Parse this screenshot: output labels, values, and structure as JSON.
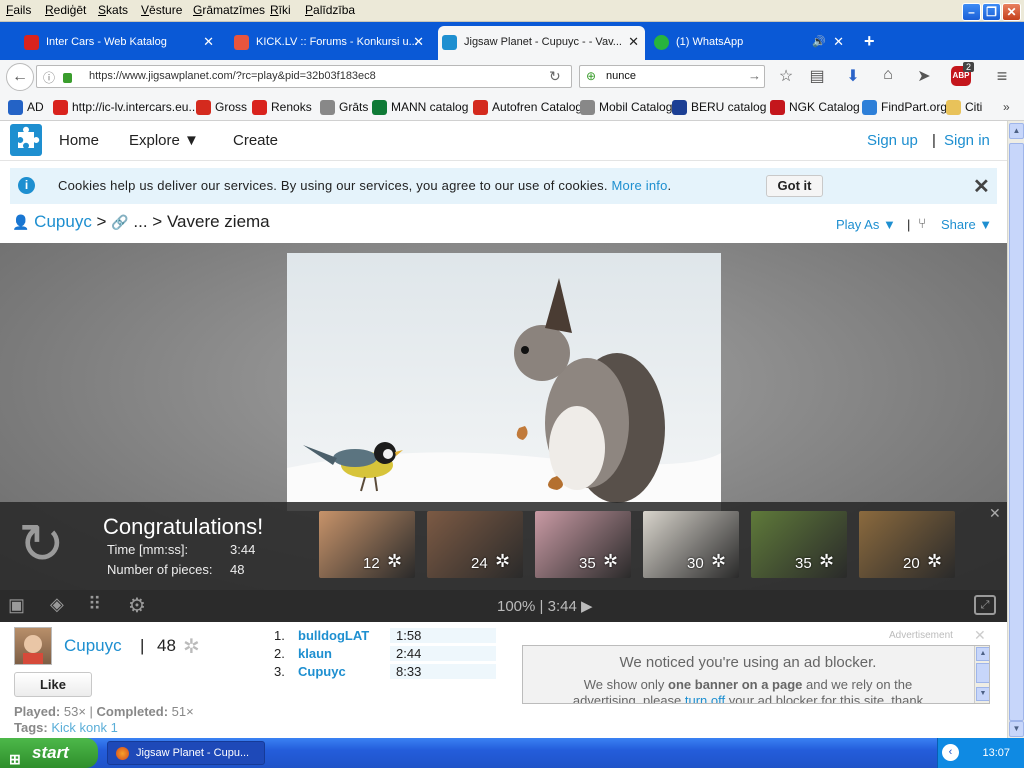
{
  "menu": [
    "Fails",
    "Rediģēt",
    "Skats",
    "Vēsture",
    "Grāmatzīmes",
    "Rīki",
    "Palīdzība"
  ],
  "tabs": [
    {
      "label": "Inter Cars - Web Katalog",
      "color": "#d9231d"
    },
    {
      "label": "KICK.LV :: Forums - Konkursi u...",
      "color": "#e8553d"
    },
    {
      "label": "Jigsaw Planet - Cupuyc - - Vav...",
      "color": "#1e8fd0"
    },
    {
      "label": "(1) WhatsApp",
      "color": "#27b43e"
    }
  ],
  "address": {
    "url": "https://www.jigsawplanet.com/?rc=play&pid=32b03f183ec8",
    "search_value": "nunce"
  },
  "abp_badge": "2",
  "bookmarks": [
    {
      "label": "AD",
      "color": "#2463c6"
    },
    {
      "label": "http://ic-lv.intercars.eu...",
      "color": "#d9231d"
    },
    {
      "label": "Gross",
      "color": "#d42a1e"
    },
    {
      "label": "Renoks",
      "color": "#d9231d"
    },
    {
      "label": "Grāts",
      "color": "#888888"
    },
    {
      "label": "MANN catalog",
      "color": "#0f7a36"
    },
    {
      "label": "Autofren Catalog",
      "color": "#d42a1e"
    },
    {
      "label": "Mobil Catalog",
      "color": "#888888"
    },
    {
      "label": "BERU catalog",
      "color": "#1c3f94"
    },
    {
      "label": "NGK Catalog",
      "color": "#c4161c"
    },
    {
      "label": "FindPart.org",
      "color": "#2d7fd8"
    },
    {
      "label": "Citi",
      "color": "#e8c25a"
    }
  ],
  "site_nav": {
    "home": "Home",
    "explore": "Explore ▼",
    "create": "Create",
    "sign_up": "Sign up",
    "sep": "|",
    "sign_in": "Sign in"
  },
  "cookie": {
    "text": "Cookies help us deliver our services. By using our services, you agree to our use of cookies.",
    "more": "More info",
    "dot": ".",
    "got_it": "Got it"
  },
  "breadcrumb": {
    "user": "Cupuyc",
    "gt1": ">",
    "dots": "...",
    "gt2": ">",
    "title": "Vavere ziema"
  },
  "actions": {
    "play_as": "Play As ▼",
    "sep": "|",
    "share": "Share ▼"
  },
  "congrats": {
    "heading": "Congratulations!",
    "time_label": "Time [mm:ss]:",
    "time_value": "3:44",
    "pieces_label": "Number of pieces:",
    "pieces_value": "48",
    "thumbs": [
      {
        "pieces": "12",
        "color": "#c7936a"
      },
      {
        "pieces": "24",
        "color": "#7c5a44"
      },
      {
        "pieces": "35",
        "color": "#c99aa4"
      },
      {
        "pieces": "30",
        "color": "#d8d4cc"
      },
      {
        "pieces": "35",
        "color": "#5f7a3a"
      },
      {
        "pieces": "20",
        "color": "#8b6a3e"
      }
    ]
  },
  "toolbar": {
    "status": "100% | 3:44 ▶"
  },
  "owner": {
    "name": "Cupuyc",
    "sep": "|",
    "pieces": "48",
    "like": "Like",
    "played_label": "Played:",
    "played": "53×",
    "completed_label": "Completed:",
    "completed": "51×",
    "tags_label": "Tags:",
    "tags": "Kick konk 1"
  },
  "leaderboard": [
    {
      "rank": "1.",
      "name": "bulldogLAT",
      "time": "1:58"
    },
    {
      "rank": "2.",
      "name": "klaun",
      "time": "2:44"
    },
    {
      "rank": "3.",
      "name": "Cupuyc",
      "time": "8:33"
    }
  ],
  "ad": {
    "label": "Advertisement",
    "heading": "We noticed you're using an ad blocker.",
    "line1_a": "We show only ",
    "line1_b": "one banner on a page",
    "line1_c": " and we rely on the",
    "line2_a": "advertising, please ",
    "line2_b": "turn off",
    "line2_c": " your ad blocker for this site, thank"
  },
  "taskbar": {
    "start": "start",
    "window": "Jigsaw Planet - Cupu...",
    "clock": "13:07"
  }
}
